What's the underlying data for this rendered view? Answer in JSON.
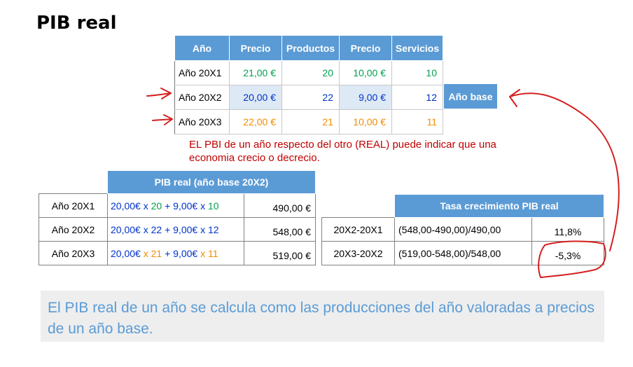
{
  "title": "PIB real",
  "top_table": {
    "headers": [
      "Año",
      "Precio",
      "Productos",
      "Precio",
      "Servicios"
    ],
    "rows": [
      {
        "year": "Año 20X1",
        "price_p": "21,00 €",
        "products": "20",
        "price_s": "10,00 €",
        "services": "10",
        "color": "#00a050"
      },
      {
        "year": "Año 20X2",
        "price_p": "20,00 €",
        "products": "22",
        "price_s": "9,00 €",
        "services": "12",
        "color": "#0033cc"
      },
      {
        "year": "Año 20X3",
        "price_p": "22,00 €",
        "products": "21",
        "price_s": "10,00 €",
        "services": "11",
        "color": "#f08c00"
      }
    ]
  },
  "base_label": "Año base",
  "note": "EL PBI de un año respecto del otro (REAL) puede indicar que una economia crecio o decrecio.",
  "pib_table": {
    "header": "PIB real (año base 20X2)",
    "rows": [
      {
        "year": "Año 20X1",
        "a": "20,00€",
        "x1": " x ",
        "q1": "20",
        "plus": " + ",
        "b": "9,00€",
        "x2": " x ",
        "q2": "10",
        "q_color": "green",
        "result": "490,00 €"
      },
      {
        "year": "Año 20X2",
        "a": "20,00€",
        "x1": " x ",
        "q1": "22",
        "plus": " + ",
        "b": "9,00€",
        "x2": " x ",
        "q2": "12",
        "q_color": "blue",
        "result": "548,00 €"
      },
      {
        "year": "Año 20X3",
        "a": "20,00€",
        "x1": " x ",
        "q1": "21",
        "plus": " + ",
        "b": "9,00€",
        "x2": " x ",
        "q2": "11",
        "q_color": "orange",
        "result": "519,00 €"
      }
    ]
  },
  "growth_table": {
    "header": "Tasa crecimiento PIB real",
    "rows": [
      {
        "period": "20X2-20X1",
        "calc": "(548,00-490,00)/490,00",
        "rate": "11,8%"
      },
      {
        "period": "20X3-20X2",
        "calc": "(519,00-548,00)/548,00",
        "rate": "-5,3%"
      }
    ]
  },
  "callout": "El PIB real de un año se calcula como las producciones del año valoradas a precios de un año base.",
  "colors": {
    "header_blue": "#5b9bd5",
    "annotation_red": "#c00000"
  }
}
